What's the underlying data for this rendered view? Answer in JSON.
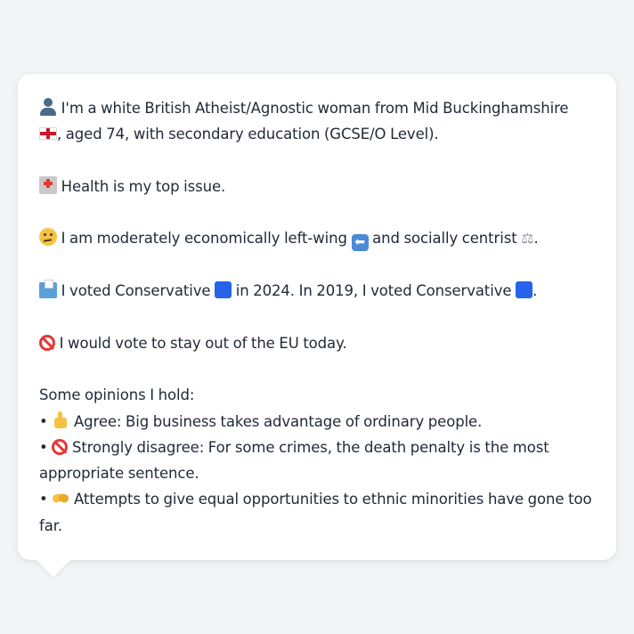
{
  "profile": {
    "intro": {
      "icon": "user-silhouette-icon",
      "line1": " I'm a white British Atheist/Agnostic woman from Mid Buckinghamshire",
      "flag_icon": "england-flag-icon",
      "line2": ", aged 74, with secondary education (GCSE/O Level)."
    },
    "top_issue": {
      "icon": "hospital-icon",
      "text": " Health is my top issue."
    },
    "ideology": {
      "icon": "thinking-face-icon",
      "text_a": " I am moderately economically left-wing ",
      "left_arrow_icon": "left-arrow-icon",
      "left_arrow_glyph": "⬅",
      "text_b": " and socially centrist ",
      "scale_icon": "balance-scale-icon",
      "scale_glyph": "⚖",
      "text_c": "."
    },
    "voting": {
      "icon": "ballot-box-icon",
      "text_a": " I voted Conservative ",
      "party_color": "#2563eb",
      "text_b": " in 2024. In 2019, I voted Conservative ",
      "text_c": "."
    },
    "eu": {
      "icon": "no-entry-icon",
      "text": " I would vote to stay out of the EU today."
    },
    "opinions": {
      "heading": "Some opinions I hold:",
      "bullet": "•",
      "items": [
        {
          "icon": "thumbs-up-icon",
          "text": " Agree: Big business takes advantage of ordinary people."
        },
        {
          "icon": "no-entry-icon",
          "text_line1": " Strongly disagree: For some crimes, the death penalty is the most",
          "text_line2": "appropriate sentence."
        },
        {
          "icon": "handshake-icon",
          "text_line1": " Attempts to give equal opportunities to ethnic minorities have gone too",
          "text_line2": "far."
        }
      ]
    }
  }
}
